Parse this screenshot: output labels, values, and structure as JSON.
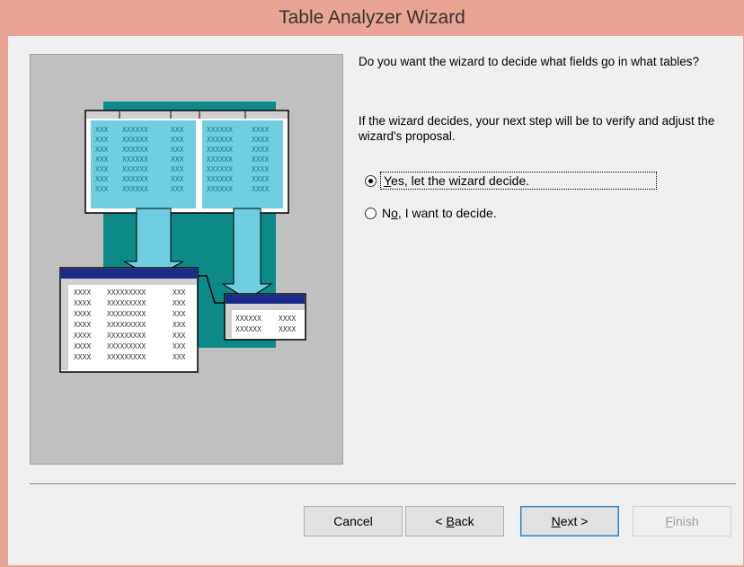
{
  "window": {
    "title": "Table Analyzer Wizard"
  },
  "content": {
    "prompt": "Do you want the wizard to decide what fields go in what tables?",
    "description": "If the wizard decides, your next step will be to verify and adjust the wizard's proposal."
  },
  "options": [
    {
      "mnemonic": "Y",
      "rest": "es, let the wizard decide.",
      "selected": true
    },
    {
      "prefix": "N",
      "mnemonic": "o",
      "rest": ", I want to decide.",
      "selected": false
    }
  ],
  "illustration": {
    "cell_a": "XXX",
    "cell_b": "XXXXXX",
    "cell_c": "XXXX",
    "cell_d": "XXXXXXXXX",
    "colors": {
      "teal": "#0d8a88",
      "light_blue": "#6fcfe0",
      "navy": "#1a2a8a"
    }
  },
  "buttons": {
    "cancel": "Cancel",
    "back": {
      "prefix": "< ",
      "mnemonic": "B",
      "rest": "ack"
    },
    "next": {
      "mnemonic": "N",
      "rest": "ext >"
    },
    "finish": {
      "mnemonic": "F",
      "rest": "inish"
    }
  }
}
